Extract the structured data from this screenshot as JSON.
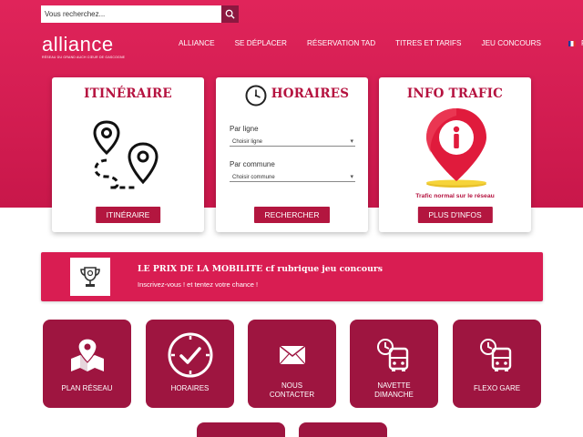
{
  "search": {
    "placeholder": "Vous recherchez..."
  },
  "logo": {
    "name": "alliance",
    "tagline": "RÉSEAU DU GRAND AUCH CŒUR DE GASCOGNE"
  },
  "nav": {
    "items": [
      "ALLIANCE",
      "SE DÉPLACER",
      "RÉSERVATION TAD",
      "TITRES ET TARIFS",
      "JEU CONCOURS"
    ],
    "language": "FR"
  },
  "cards": {
    "itineraire": {
      "title": "ITINÉRAIRE",
      "button": "ITINÉRAIRE"
    },
    "horaires": {
      "title": "HORAIRES",
      "line_label": "Par ligne",
      "line_select": "Choisir ligne",
      "commune_label": "Par commune",
      "commune_select": "Choisir commune",
      "button": "RECHERCHER"
    },
    "trafic": {
      "title": "INFO TRAFIC",
      "status": "Trafic normal sur le réseau",
      "button": "PLUS D'INFOS"
    }
  },
  "banner": {
    "title": "LE PRIX DE LA MOBILITE cf rubrique jeu concours",
    "subtitle": "Inscrivez-vous !  et tentez votre chance !"
  },
  "tiles": [
    {
      "label": "PLAN RÉSEAU",
      "icon": "map-pin-icon"
    },
    {
      "label": "HORAIRES",
      "icon": "clock-icon"
    },
    {
      "label": "NOUS\nCONTACTER",
      "icon": "envelope-icon"
    },
    {
      "label": "NAVETTE\nDIMANCHE",
      "icon": "bus-clock-icon"
    },
    {
      "label": "FLEXO GARE",
      "icon": "bus-clock-icon"
    }
  ],
  "colors": {
    "primary": "#d91d52",
    "dark": "#9e1540",
    "accent": "#b5123f"
  }
}
